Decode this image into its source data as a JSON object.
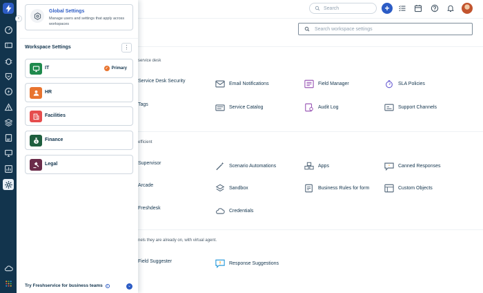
{
  "topbar": {
    "search_placeholder": "Search",
    "plus_label": "+"
  },
  "workspace_search": {
    "placeholder": "Search workspace settings"
  },
  "global_settings": {
    "title": "Global Settings",
    "description": "Manage users and settings that apply across workspaces"
  },
  "workspace_settings": {
    "heading": "Workspace Settings",
    "kebab": "⋮",
    "primary_label": "Primary",
    "items": [
      {
        "label": "IT",
        "color": "#1f8a4d"
      },
      {
        "label": "HR",
        "color": "#e8742f"
      },
      {
        "label": "Facilities",
        "color": "#e54d4d"
      },
      {
        "label": "Finance",
        "color": "#1e5e3e"
      },
      {
        "label": "Legal",
        "color": "#6b2c4a"
      }
    ]
  },
  "try_business": "Try Freshservice for business teams",
  "sections": {
    "s1_partial": "service desk",
    "s2_partial": "efficient",
    "s3_partial": "nels they are already on, with virtual agent."
  },
  "tiles": {
    "service_desk_security": "Service Desk Security",
    "email_notifications": "Email Notifications",
    "field_manager": "Field Manager",
    "sla_policies": "SLA Policies",
    "tags": "Tags",
    "service_catalog": "Service Catalog",
    "audit_log": "Audit Log",
    "support_channels": "Support Channels",
    "supervisor": "Supervisor",
    "scenario_automations": "Scenario Automations",
    "apps": "Apps",
    "canned_responses": "Canned Responses",
    "arcade": "Arcade",
    "sandbox": "Sandbox",
    "business_rules": "Business Rules for form",
    "custom_objects": "Custom Objects",
    "freshdesk": "Freshdesk",
    "credentials": "Credentials",
    "field_suggester": "Field Suggester",
    "response_suggestions": "Response Suggestions"
  },
  "colors": {
    "rail": "#12344d",
    "accent": "#2c5cc5",
    "primary_badge": "#e8742f"
  }
}
